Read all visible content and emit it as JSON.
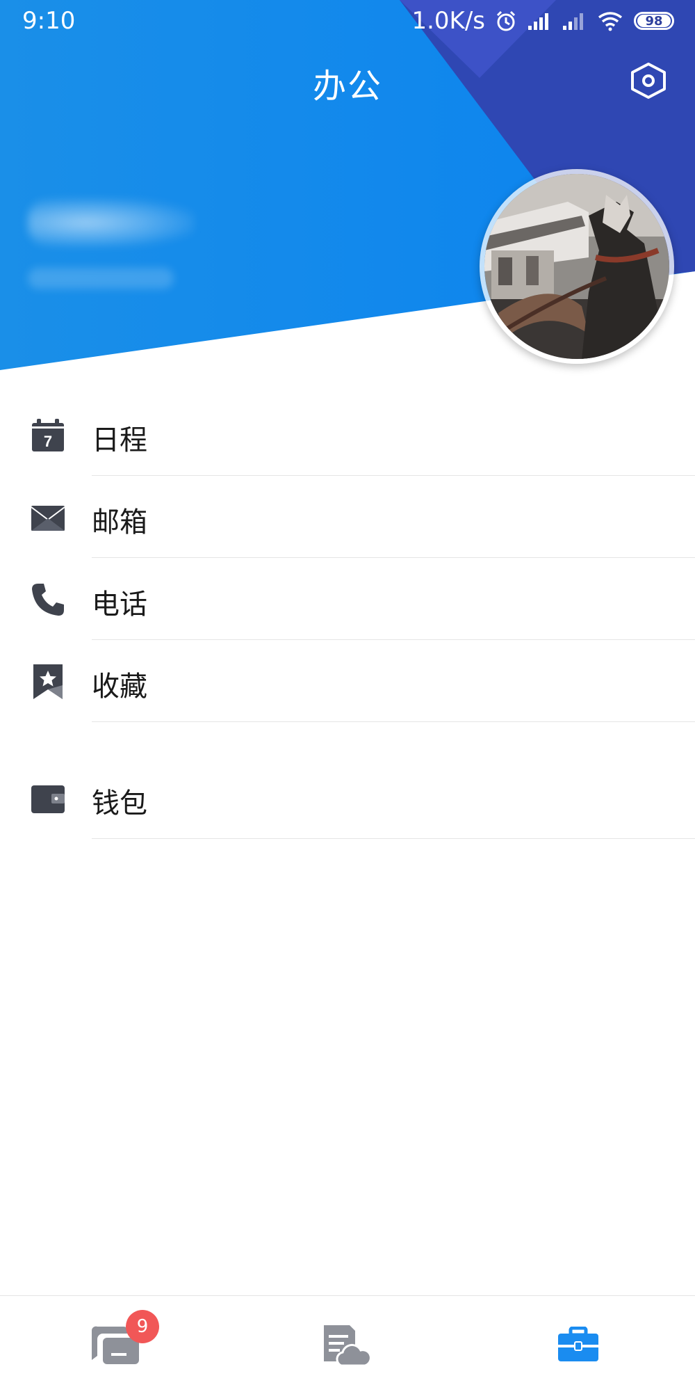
{
  "status_bar": {
    "time": "9:10",
    "net_speed": "1.0K/s",
    "battery": "98",
    "icons": [
      "alarm-icon",
      "signal-icon",
      "signal-icon",
      "wifi-icon",
      "battery-icon"
    ]
  },
  "header": {
    "title": "办公",
    "settings_icon": "hexagon-settings-icon",
    "colors": {
      "blue": "#0a86ee",
      "indigo": "#2f48b0",
      "violet": "#3b4fc6"
    }
  },
  "menu": {
    "items": [
      {
        "label": "日程",
        "icon": "calendar-icon",
        "calendar_day": "7"
      },
      {
        "label": "邮箱",
        "icon": "mail-icon"
      },
      {
        "label": "电话",
        "icon": "phone-icon"
      },
      {
        "label": "收藏",
        "icon": "bookmark-star-icon"
      },
      {
        "label": "钱包",
        "icon": "wallet-icon"
      }
    ],
    "icon_color": "#3f434d"
  },
  "bottom_nav": {
    "tabs": [
      {
        "icon": "chat-icon",
        "badge": "9"
      },
      {
        "icon": "cloud-doc-icon"
      },
      {
        "icon": "briefcase-icon",
        "active": true
      }
    ],
    "active_color": "#1a8cf0",
    "inactive_color": "#8e9199"
  }
}
